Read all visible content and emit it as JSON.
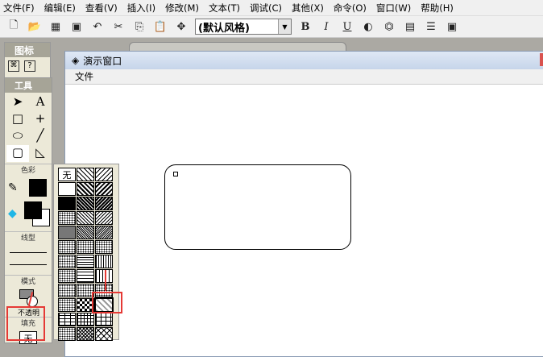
{
  "menu": [
    "文件(F)",
    "编辑(E)",
    "查看(V)",
    "插入(I)",
    "修改(M)",
    "文本(T)",
    "调试(C)",
    "其他(X)",
    "命令(O)",
    "窗口(W)",
    "帮助(H)"
  ],
  "toolbar": {
    "style_value": "(默认风格)",
    "bold": "B",
    "italic": "I",
    "underline": "U"
  },
  "icon_panel": {
    "title": "图标"
  },
  "tools_panel": {
    "title": "工具",
    "color_label": "色彩",
    "line_label": "线型",
    "mode_label": "模式",
    "opacity_label": "不透明",
    "fill_label": "填充",
    "fill_value": "无"
  },
  "window": {
    "title": "演示窗口",
    "menu_file": "文件"
  },
  "palette": {
    "none_label": "无",
    "patterns": [
      "none",
      "diag1",
      "diag2",
      "white",
      "diag3",
      "diag4",
      "black",
      "diag5",
      "diag6",
      "dots-dense",
      "diag7",
      "diag8",
      "gray",
      "diag9",
      "diag10",
      "dots1",
      "weave1",
      "weave2",
      "dots2",
      "hlines",
      "vlines",
      "dots3",
      "hlines2",
      "vlines2",
      "dots4",
      "dots5",
      "dots6",
      "scales",
      "checker",
      "diamonds",
      "bricks",
      "grid",
      "grid2",
      "zigzag",
      "crosshatch",
      "lattice"
    ],
    "selected": 29
  }
}
